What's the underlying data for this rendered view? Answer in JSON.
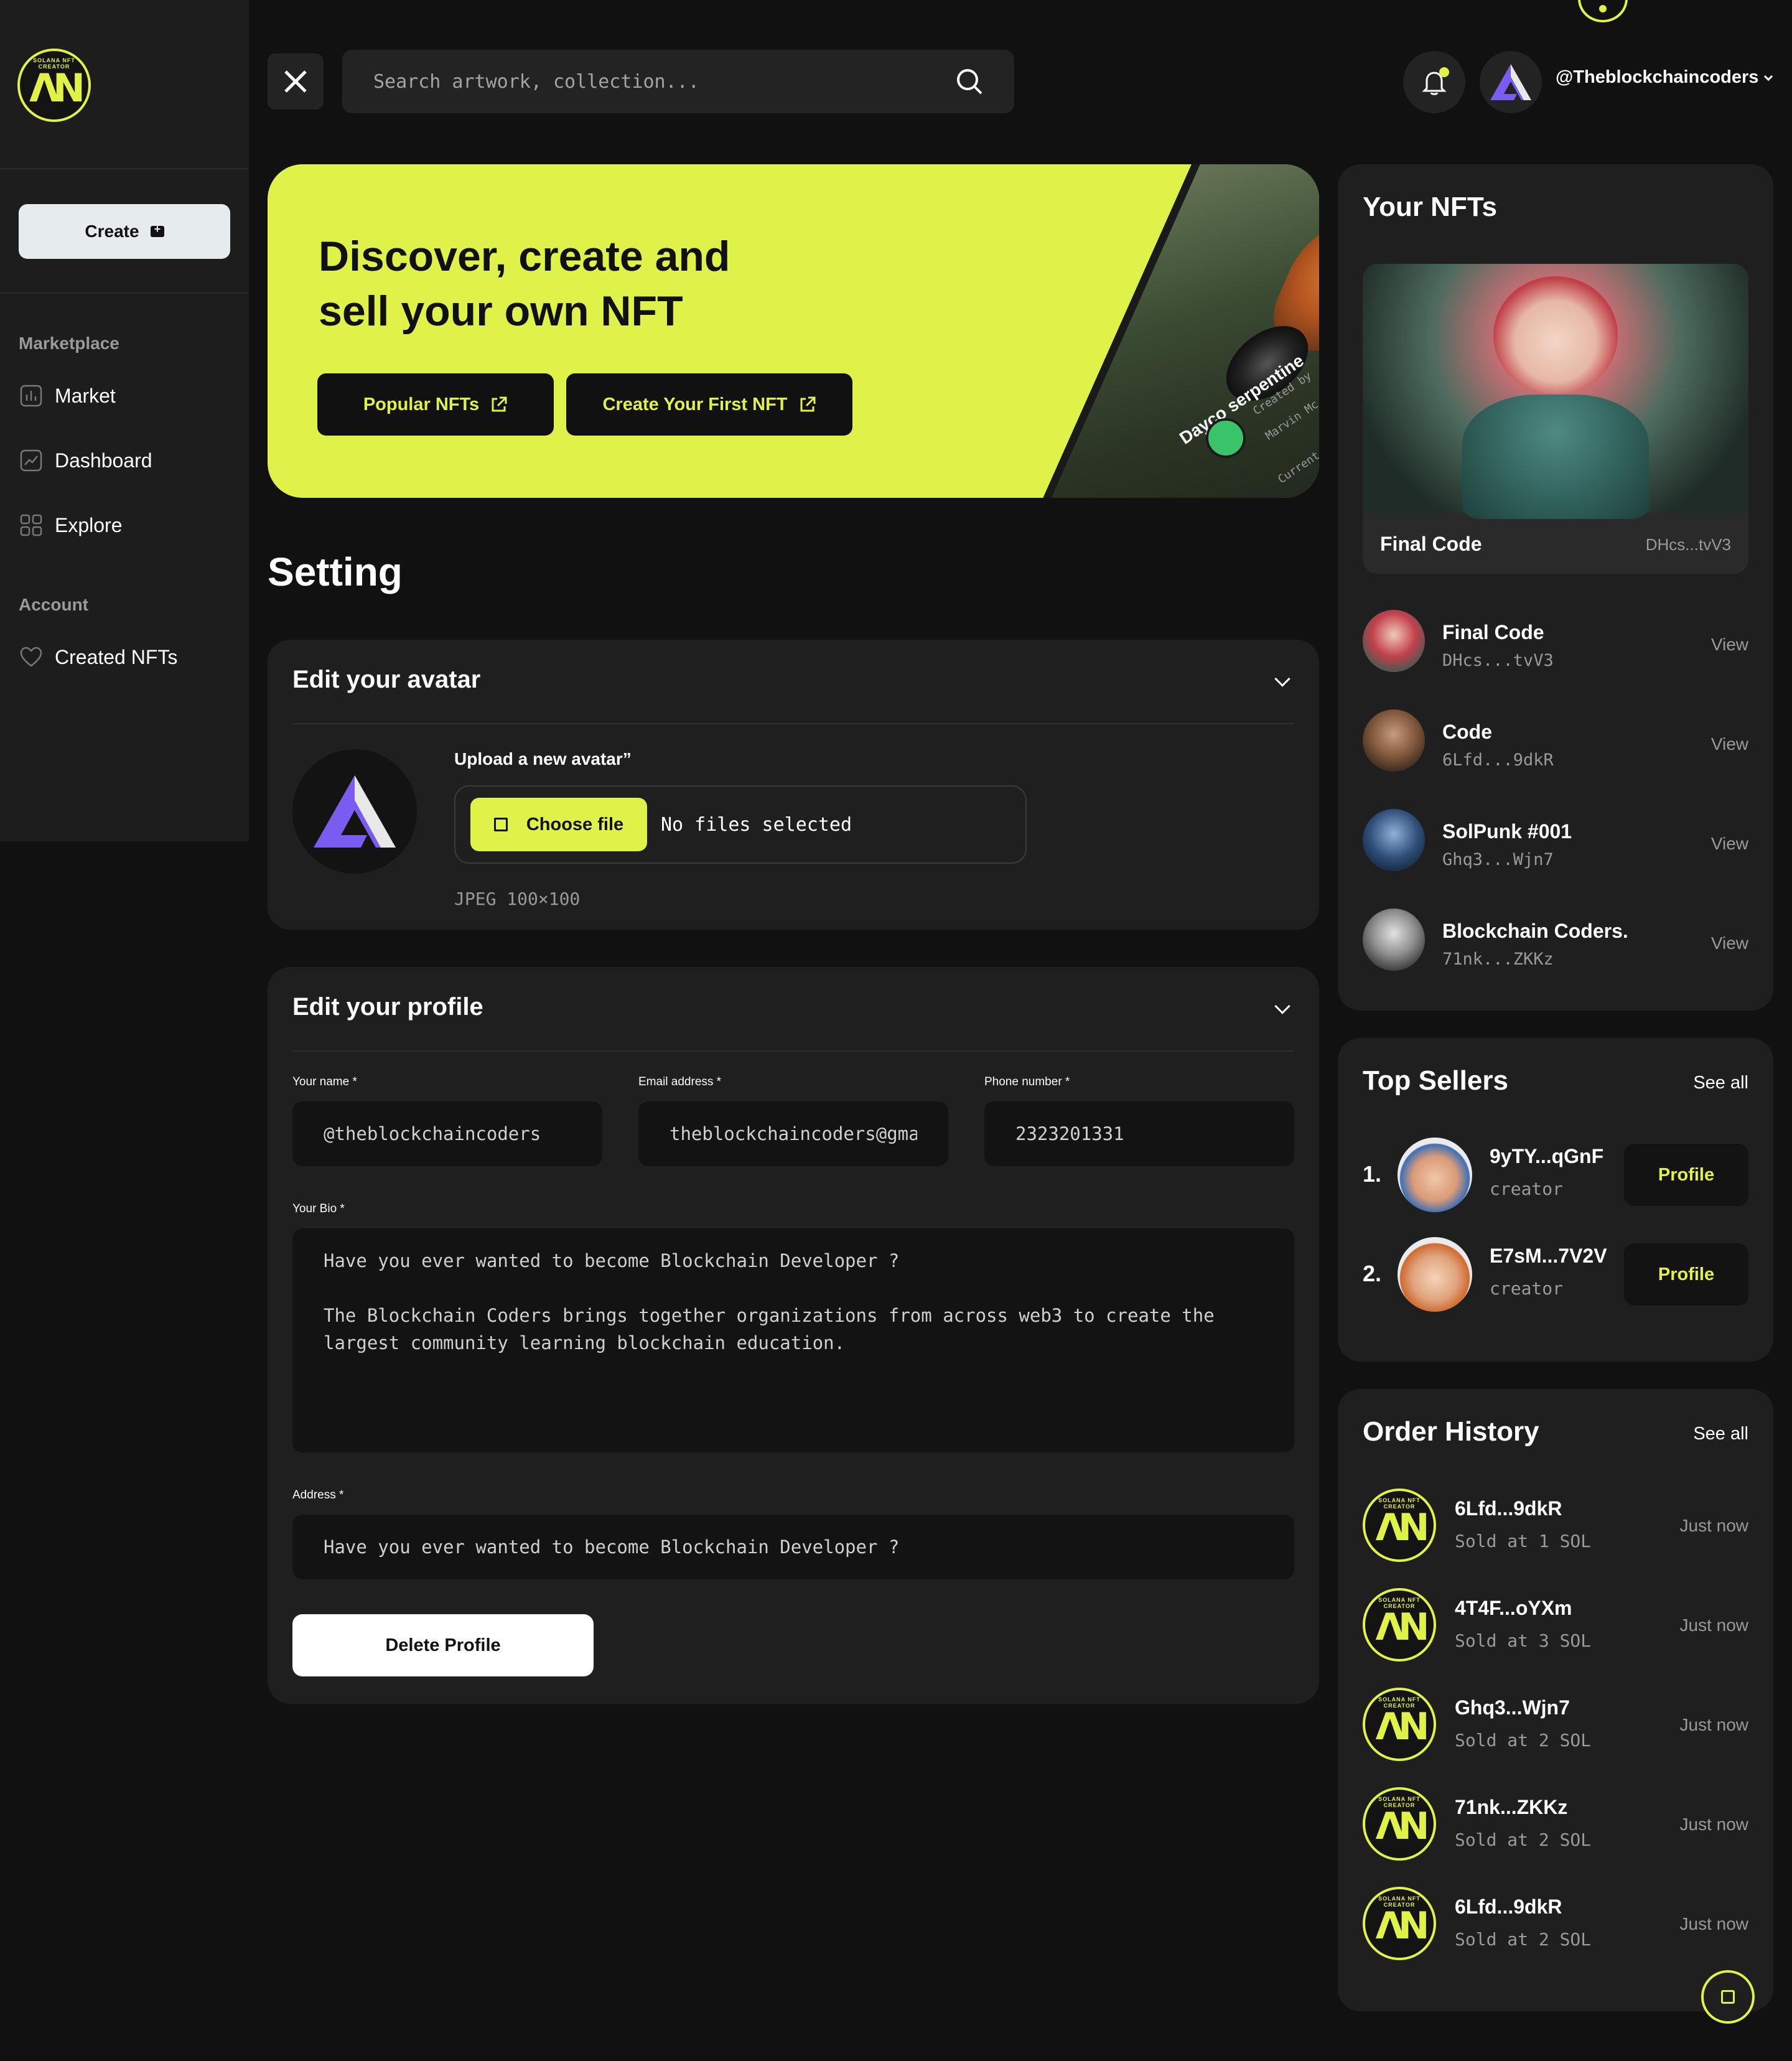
{
  "brand": {
    "logo_ring_text": "SOLANA NFT CREATOR",
    "accent": "#e0f148"
  },
  "sidebar": {
    "create_label": "Create",
    "sections": [
      {
        "title": "Marketplace",
        "items": [
          {
            "label": "Market",
            "icon": "chart-icon"
          },
          {
            "label": "Dashboard",
            "icon": "trend-icon"
          },
          {
            "label": "Explore",
            "icon": "grid-icon"
          }
        ]
      },
      {
        "title": "Account",
        "items": [
          {
            "label": "Created NFTs",
            "icon": "heart-icon"
          }
        ]
      }
    ]
  },
  "topbar": {
    "search_placeholder": "Search artwork, collection...",
    "username": "@Theblockchaincoders"
  },
  "hero": {
    "title": "Discover, create and sell your own NFT",
    "buttons": [
      "Popular NFTs",
      "Create Your First NFT"
    ],
    "art_caption": "Dayco serpentine",
    "art_creator": "Created by",
    "art_creator_name": "Marvin Mc",
    "art_bid": "Current Bid"
  },
  "setting": {
    "title": "Setting",
    "avatar_card": {
      "title": "Edit your avatar",
      "upload_label": "Upload a new avatar”",
      "choose_file": "Choose file",
      "no_file": "No files selected",
      "hint": "JPEG 100×100"
    },
    "profile_card": {
      "title": "Edit your profile",
      "name_label": "Your name *",
      "name_value": "@theblockchaincoders",
      "email_label": "Email address *",
      "email_value": "theblockchaincoders@gmail.com",
      "phone_label": "Phone number *",
      "phone_value": "2323201331",
      "bio_label": "Your Bio *",
      "bio_value": "Have you ever wanted to become Blockchain Developer ?\n\nThe Blockchain Coders brings together organizations from across web3 to create the largest community learning blockchain education.",
      "address_label": "Address *",
      "address_value": "Have you ever wanted to become Blockchain Developer ?",
      "delete_label": "Delete Profile"
    }
  },
  "your_nfts": {
    "title": "Your NFTs",
    "featured": {
      "name": "Final Code",
      "address": "DHcs...tvV3"
    },
    "items": [
      {
        "name": "Final Code",
        "address": "DHcs...tvV3",
        "action": "View"
      },
      {
        "name": "Code",
        "address": "6Lfd...9dkR",
        "action": "View"
      },
      {
        "name": "SolPunk #001",
        "address": "Ghq3...Wjn7",
        "action": "View"
      },
      {
        "name": "Blockchain Coders.",
        "address": "71nk...ZKKz",
        "action": "View"
      }
    ]
  },
  "top_sellers": {
    "title": "Top Sellers",
    "see_all": "See all",
    "items": [
      {
        "rank": "1.",
        "name": "9yTY...qGnF",
        "role": "creator",
        "action": "Profile"
      },
      {
        "rank": "2.",
        "name": "E7sM...7V2V",
        "role": "creator",
        "action": "Profile"
      }
    ]
  },
  "order_history": {
    "title": "Order History",
    "see_all": "See all",
    "items": [
      {
        "id": "6Lfd...9dkR",
        "sold": "Sold at 1 SOL",
        "time": "Just now"
      },
      {
        "id": "4T4F...oYXm",
        "sold": "Sold at 3 SOL",
        "time": "Just now"
      },
      {
        "id": "Ghq3...Wjn7",
        "sold": "Sold at 2 SOL",
        "time": "Just now"
      },
      {
        "id": "71nk...ZKKz",
        "sold": "Sold at 2 SOL",
        "time": "Just now"
      },
      {
        "id": "6Lfd...9dkR",
        "sold": "Sold at 2 SOL",
        "time": "Just now"
      }
    ]
  }
}
